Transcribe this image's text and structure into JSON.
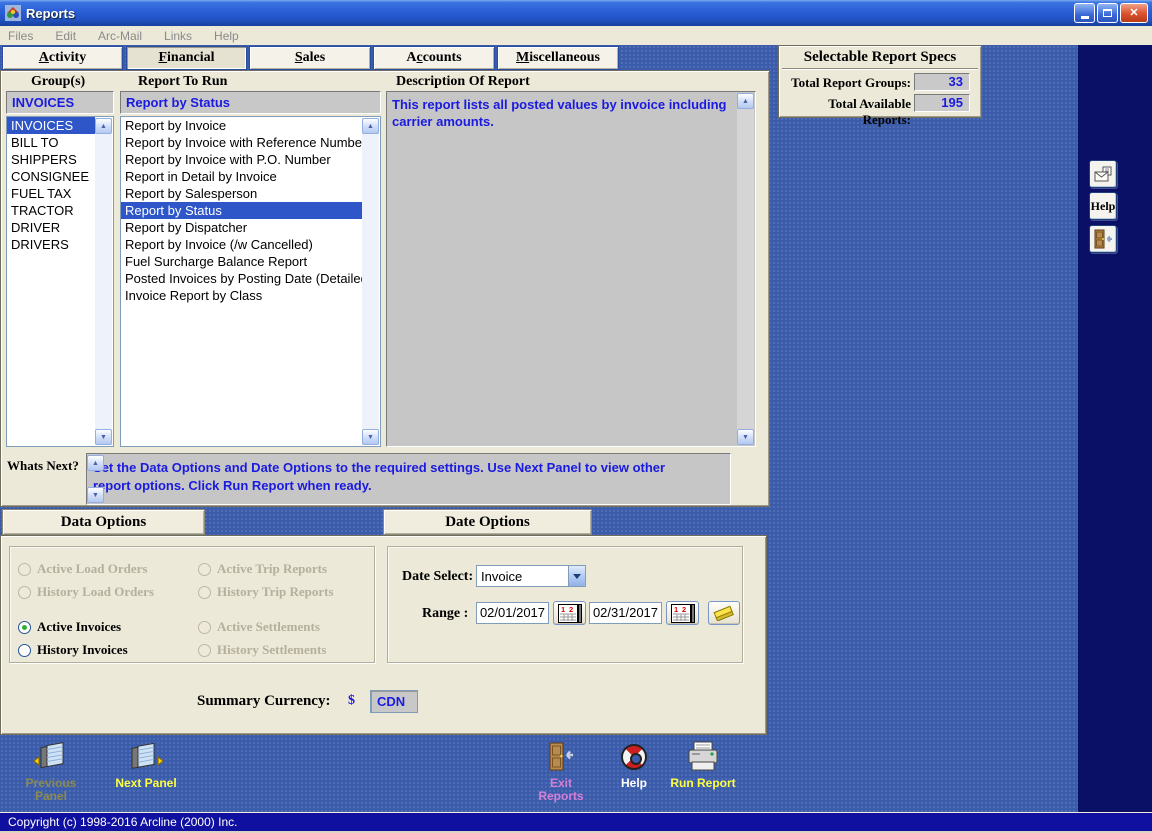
{
  "window": {
    "title": "Reports"
  },
  "menu": {
    "items": [
      "Files",
      "Edit",
      "Arc-Mail",
      "Links",
      "Help"
    ]
  },
  "tabs": [
    {
      "pre": "",
      "u": "A",
      "post": "ctivity"
    },
    {
      "pre": "",
      "u": "F",
      "post": "inancial"
    },
    {
      "pre": "",
      "u": "S",
      "post": "ales"
    },
    {
      "pre": "A",
      "u": "c",
      "post": "counts"
    },
    {
      "pre": "",
      "u": "M",
      "post": "iscellaneous"
    }
  ],
  "specs": {
    "title": "Selectable Report Specs",
    "rows": [
      {
        "label": "Total Report Groups:",
        "value": "33"
      },
      {
        "label": "Total Available Reports:",
        "value": "195"
      }
    ]
  },
  "side_buttons": {
    "help_label": "Help"
  },
  "groups": {
    "header": "Group(s)",
    "selected": "INVOICES",
    "items": [
      "INVOICES",
      "BILL TO",
      "SHIPPERS",
      "CONSIGNEE",
      "FUEL TAX",
      "TRACTOR",
      "DRIVER",
      "DRIVERS"
    ]
  },
  "reports": {
    "header": "Report To Run",
    "selected": "Report by Status",
    "items": [
      "Report by Invoice",
      "Report by Invoice with Reference Number",
      "Report by Invoice with P.O. Number",
      "Report in Detail by Invoice",
      "Report by Salesperson",
      "Report by Status",
      "Report by Dispatcher",
      "Report by Invoice (/w Cancelled)",
      "Fuel Surcharge Balance Report",
      "Posted Invoices by Posting Date (Detailed)",
      "Invoice Report by Class"
    ]
  },
  "description": {
    "header": "Description Of Report",
    "text": "This report lists all posted values by invoice including carrier amounts."
  },
  "whats_next": {
    "label": "Whats Next?",
    "text": "Set the Data Options and Date Options to the required settings. Use Next Panel to view other report options. Click Run Report when ready."
  },
  "options_tabs": {
    "data_label": "Data Options",
    "date_label": "Date Options"
  },
  "data_options": {
    "left": [
      {
        "label": "Active Load Orders",
        "enabled": false,
        "checked": false
      },
      {
        "label": "History Load Orders",
        "enabled": false,
        "checked": false
      },
      {
        "label": "Active Invoices",
        "enabled": true,
        "checked": true
      },
      {
        "label": "History Invoices",
        "enabled": true,
        "checked": false
      }
    ],
    "right": [
      {
        "label": "Active Trip Reports",
        "enabled": false,
        "checked": false
      },
      {
        "label": "History Trip Reports",
        "enabled": false,
        "checked": false
      },
      {
        "label": "Active Settlements",
        "enabled": false,
        "checked": false
      },
      {
        "label": "History Settlements",
        "enabled": false,
        "checked": false
      }
    ]
  },
  "date_options": {
    "select_label": "Date Select:",
    "select_value": "Invoice",
    "range_label": "Range :",
    "from": "02/01/2017",
    "to": "02/31/2017"
  },
  "summary": {
    "label": "Summary Currency:",
    "symbol": "$",
    "currency": "CDN"
  },
  "toolbar": {
    "previous": "Previous Panel",
    "next": "Next Panel",
    "exit": "Exit Reports",
    "help": "Help",
    "run": "Run Report"
  },
  "statusbar": {
    "text": "Copyright (c) 1998-2016 Arcline (2000) Inc."
  },
  "icons": {
    "scroll_up": "▲",
    "scroll_down": "▼",
    "close": "✕",
    "app": "pinwheel",
    "mail": "envelope",
    "exit_door": "door-with-left-arrow",
    "help_ring": "life-ring",
    "printer": "printer",
    "panel_prev": "panel-with-left-arrow",
    "panel_next": "panel-with-right-arrow",
    "calendar": "calendar",
    "eraser": "eraser"
  }
}
